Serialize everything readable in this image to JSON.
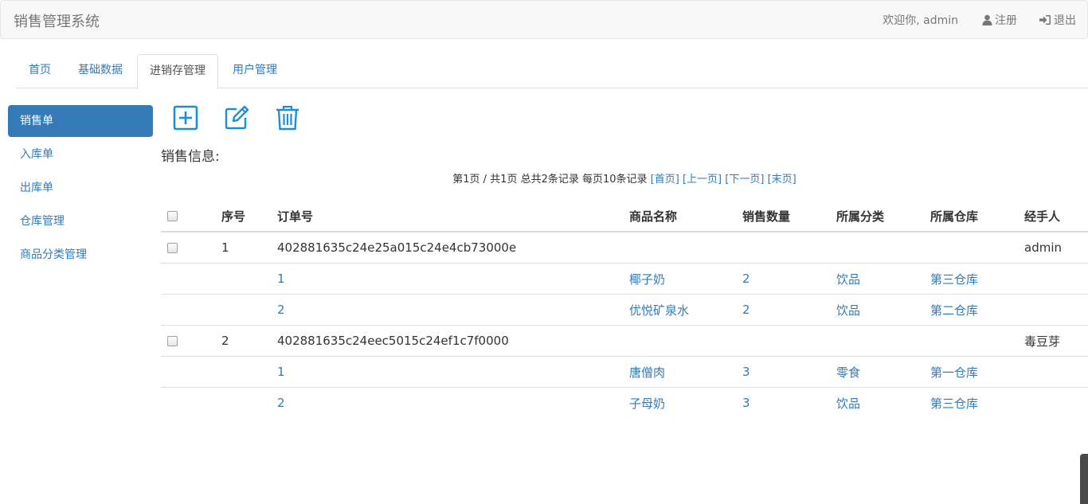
{
  "header": {
    "brand": "销售管理系统",
    "welcome": "欢迎你, admin",
    "register_label": "注册",
    "logout_label": "退出",
    "register_icon": "user-icon",
    "logout_icon": "sign-in-icon"
  },
  "tabs": [
    {
      "label": "首页",
      "active": false
    },
    {
      "label": "基础数据",
      "active": false
    },
    {
      "label": "进销存管理",
      "active": true
    },
    {
      "label": "用户管理",
      "active": false
    }
  ],
  "sidebar": {
    "items": [
      {
        "label": "销售单",
        "active": true
      },
      {
        "label": "入库单",
        "active": false
      },
      {
        "label": "出库单",
        "active": false
      },
      {
        "label": "仓库管理",
        "active": false
      },
      {
        "label": "商品分类管理",
        "active": false
      }
    ]
  },
  "toolbar": {
    "add_icon": "plus-square-icon",
    "edit_icon": "edit-icon",
    "delete_icon": "trash-icon",
    "icon_color": "#1a8fd6"
  },
  "main": {
    "title": "销售信息:",
    "pager": {
      "text": "第1页 / 共1页  总共2条记录 每页10条记录",
      "first": "[首页]",
      "prev": "[上一页]",
      "next": "[下一页]",
      "last": "[末页]"
    },
    "table": {
      "headers": [
        "序号",
        "订单号",
        "商品名称",
        "销售数量",
        "所属分类",
        "所属仓库",
        "经手人"
      ],
      "orders": [
        {
          "index": "1",
          "order_no": "402881635c24e25a015c24e4cb73000e",
          "handler": "admin",
          "items": [
            {
              "seq": "1",
              "product": "椰子奶",
              "qty": "2",
              "category": "饮品",
              "warehouse": "第三仓库"
            },
            {
              "seq": "2",
              "product": "优悦矿泉水",
              "qty": "2",
              "category": "饮品",
              "warehouse": "第二仓库"
            }
          ]
        },
        {
          "index": "2",
          "order_no": "402881635c24eec5015c24ef1c7f0000",
          "handler": "毒豆芽",
          "items": [
            {
              "seq": "1",
              "product": "唐僧肉",
              "qty": "3",
              "category": "零食",
              "warehouse": "第一仓库"
            },
            {
              "seq": "2",
              "product": "子母奶",
              "qty": "3",
              "category": "饮品",
              "warehouse": "第三仓库"
            }
          ]
        }
      ]
    }
  },
  "colors": {
    "primary": "#337ab7",
    "navbar_bg": "#f8f8f8",
    "border": "#dddddd"
  }
}
